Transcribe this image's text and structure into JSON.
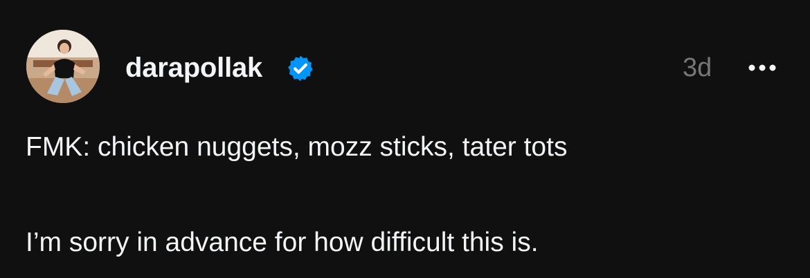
{
  "post": {
    "username": "darapollak",
    "verified": true,
    "timestamp": "3d",
    "text_lines": [
      "FMK: chicken nuggets, mozz sticks, tater tots",
      "I’m sorry in advance for how difficult this is."
    ]
  },
  "icons": {
    "verified": "verified-badge-icon",
    "more": "more-options-icon",
    "avatar": "profile-photo"
  },
  "colors": {
    "background": "#101010",
    "text": "#f3f5f7",
    "muted": "#777777",
    "verified_blue": "#0095f6"
  }
}
